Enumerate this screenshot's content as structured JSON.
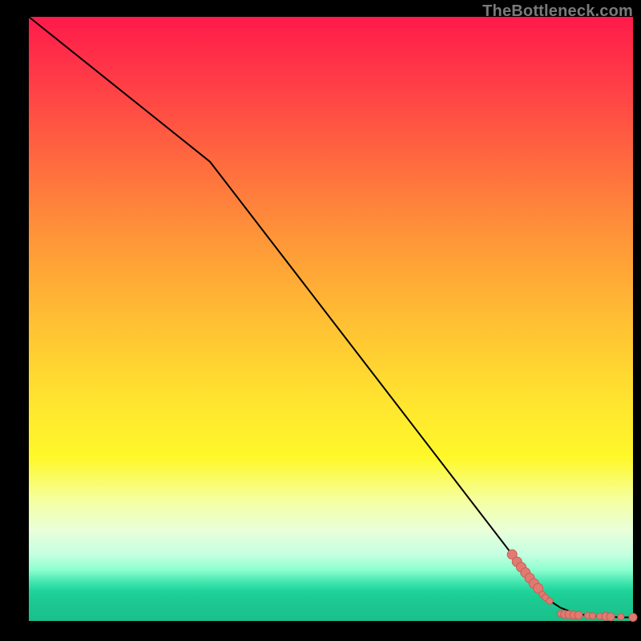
{
  "watermark": "TheBottleneck.com",
  "colors": {
    "dot_fill": "#e27a72",
    "dot_stroke": "#c95d55",
    "curve": "#000000"
  },
  "chart_data": {
    "type": "line",
    "title": "",
    "xlabel": "",
    "ylabel": "",
    "xlim": [
      0,
      100
    ],
    "ylim": [
      0,
      100
    ],
    "background": "red-yellow-green vertical gradient",
    "series": [
      {
        "name": "curve",
        "kind": "line",
        "x": [
          0,
          10,
          20,
          30,
          40,
          50,
          60,
          70,
          80,
          84,
          86,
          88,
          90,
          92,
          94,
          96,
          98,
          100
        ],
        "y": [
          100,
          92,
          84,
          76,
          63,
          50,
          37,
          24,
          11,
          5.5,
          3.5,
          2.2,
          1.4,
          1.0,
          0.8,
          0.7,
          0.6,
          0.6
        ]
      },
      {
        "name": "dots",
        "kind": "scatter",
        "points": [
          {
            "x": 80.0,
            "y": 11.0,
            "r": 6
          },
          {
            "x": 80.8,
            "y": 9.8,
            "r": 6
          },
          {
            "x": 81.5,
            "y": 8.9,
            "r": 6
          },
          {
            "x": 82.2,
            "y": 8.0,
            "r": 6
          },
          {
            "x": 82.9,
            "y": 7.1,
            "r": 6
          },
          {
            "x": 83.6,
            "y": 6.2,
            "r": 6
          },
          {
            "x": 84.3,
            "y": 5.4,
            "r": 6
          },
          {
            "x": 85.0,
            "y": 4.4,
            "r": 4
          },
          {
            "x": 85.5,
            "y": 3.9,
            "r": 4
          },
          {
            "x": 86.2,
            "y": 3.3,
            "r": 4
          },
          {
            "x": 88.0,
            "y": 1.2,
            "r": 4
          },
          {
            "x": 88.7,
            "y": 1.1,
            "r": 5
          },
          {
            "x": 89.4,
            "y": 1.05,
            "r": 5
          },
          {
            "x": 90.2,
            "y": 1.0,
            "r": 5
          },
          {
            "x": 91.0,
            "y": 0.95,
            "r": 5
          },
          {
            "x": 92.5,
            "y": 0.9,
            "r": 4
          },
          {
            "x": 93.3,
            "y": 0.85,
            "r": 4
          },
          {
            "x": 94.5,
            "y": 0.8,
            "r": 4
          },
          {
            "x": 95.5,
            "y": 0.75,
            "r": 5
          },
          {
            "x": 96.3,
            "y": 0.7,
            "r": 5
          },
          {
            "x": 98.0,
            "y": 0.7,
            "r": 4
          },
          {
            "x": 100.0,
            "y": 0.6,
            "r": 5
          }
        ]
      }
    ]
  }
}
